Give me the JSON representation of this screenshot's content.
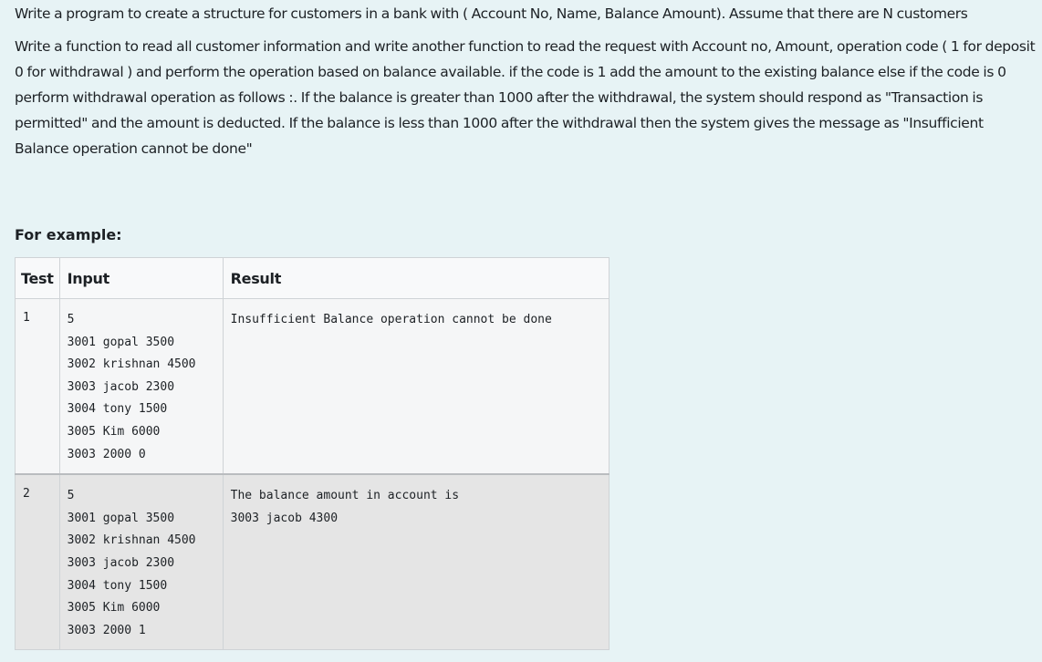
{
  "question": {
    "paragraph1": "Write a program to create a structure for customers in a bank with ( Account No, Name, Balance Amount).  Assume that there are N customers",
    "paragraph2": "Write a function to read all customer information and write another function to read the request with Account no, Amount, operation code ( 1 for deposit 0 for withdrawal ) and perform the operation based on balance available. if the code is 1 add the amount to the existing balance else if the code is 0 perform withdrawal operation as follows :.  If the balance is greater than 1000 after the withdrawal, the system should respond as \"Transaction is permitted\" and the amount is deducted.  If the balance is less than 1000 after the withdrawal then the system gives the message as \"Insufficient Balance operation cannot be done\""
  },
  "example": {
    "heading": "For example:",
    "headers": {
      "test": "Test",
      "input": "Input",
      "result": "Result"
    },
    "rows": [
      {
        "test": "1",
        "input": "5\n3001 gopal 3500\n3002 krishnan 4500\n3003 jacob 2300\n3004 tony 1500\n3005 Kim 6000\n3003 2000 0",
        "result": "Insufficient Balance operation cannot be done"
      },
      {
        "test": "2",
        "input": "5\n3001 gopal 3500\n3002 krishnan 4500\n3003 jacob 2300\n3004 tony 1500\n3005 Kim 6000\n3003 2000 1",
        "result": "The balance amount in account is\n3003 jacob 4300"
      }
    ]
  }
}
